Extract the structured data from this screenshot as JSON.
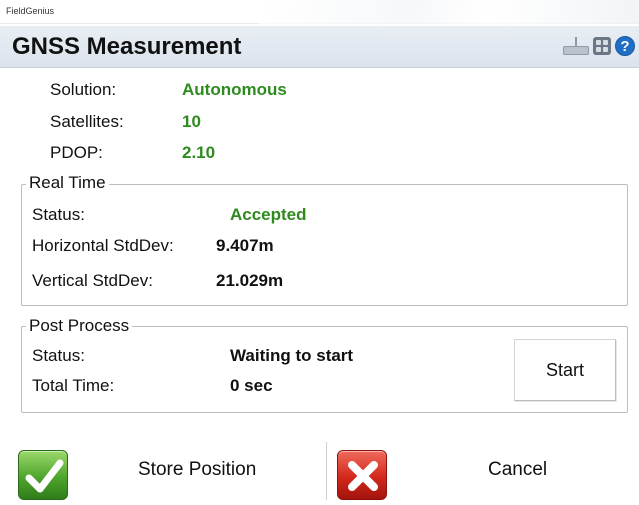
{
  "app": {
    "name": "FieldGenius"
  },
  "header": {
    "title": "GNSS Measurement",
    "icons": [
      "keyboard-icon",
      "grid-icon",
      "help-icon"
    ],
    "help_glyph": "?"
  },
  "summary": {
    "solution_label": "Solution:",
    "solution_value": "Autonomous",
    "satellites_label": "Satellites:",
    "satellites_value": "10",
    "pdop_label": "PDOP:",
    "pdop_value": "2.10"
  },
  "real_time": {
    "legend": "Real Time",
    "status_label": "Status:",
    "status_value": "Accepted",
    "hstd_label": "Horizontal StdDev:",
    "hstd_value": "9.407m",
    "vstd_label": "Vertical StdDev:",
    "vstd_value": "21.029m"
  },
  "post_process": {
    "legend": "Post Process",
    "status_label": "Status:",
    "status_value": "Waiting to start",
    "time_label": "Total Time:",
    "time_value": "0 sec",
    "start_label": "Start"
  },
  "actions": {
    "store_label": "Store Position",
    "cancel_label": "Cancel"
  },
  "colors": {
    "good": "#2e8b1e",
    "title_bar": "#dbe3ec",
    "help": "#1f6fc6",
    "accept": "#4ea52d",
    "reject": "#d2281b"
  }
}
